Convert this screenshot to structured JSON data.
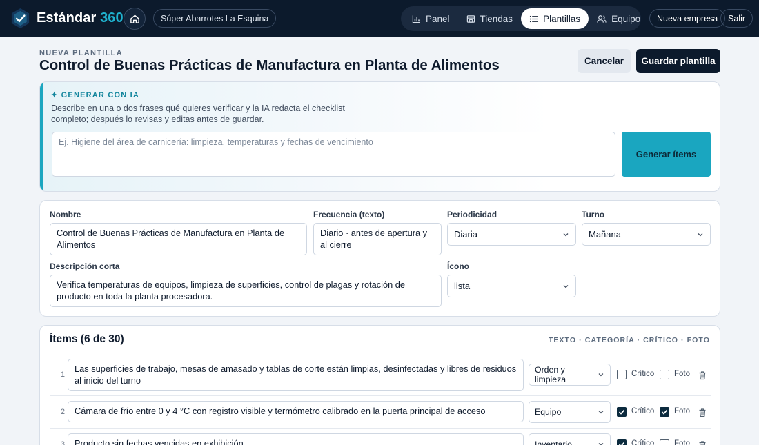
{
  "colors": {
    "topbar": "#0c1a2c",
    "accent": "#1aa6c0",
    "checked": "#0c2b3e"
  },
  "topbar": {
    "brand_name": "Estándar",
    "brand_accent": "360",
    "store": "Súper Abarrotes La Esquina",
    "nav": [
      {
        "label": "Panel",
        "icon": "bar-chart-icon"
      },
      {
        "label": "Tiendas",
        "icon": "store-icon"
      },
      {
        "label": "Plantillas",
        "icon": "list-icon",
        "active": true
      },
      {
        "label": "Equipo",
        "icon": "users-icon"
      }
    ],
    "new_company": "Nueva empresa",
    "logout": "Salir"
  },
  "header": {
    "eyebrow": "NUEVA PLANTILLA",
    "title": "Control de Buenas Prácticas de Manufactura en Planta de Alimentos",
    "cancel": "Cancelar",
    "save": "Guardar plantilla"
  },
  "ai": {
    "title": "✦ GENERAR CON IA",
    "description": "Describe en una o dos frases qué quieres verificar y la IA redacta el checklist completo; después lo revisas y editas antes de guardar.",
    "placeholder": "Ej. Higiene del área de carnicería: limpieza, temperaturas y fechas de vencimiento",
    "button": "Generar ítems"
  },
  "form": {
    "name_label": "Nombre",
    "name_value": "Control de Buenas Prácticas de Manufactura en Planta de Alimentos",
    "freq_label": "Frecuencia (texto)",
    "freq_value": "Diario · antes de apertura y al cierre",
    "period_label": "Periodicidad",
    "period_value": "Diaria",
    "shift_label": "Turno",
    "shift_value": "Mañana",
    "desc_label": "Descripción corta",
    "desc_value": "Verifica temperaturas de equipos, limpieza de superficies, control de plagas y rotación de producto en toda la planta procesadora.",
    "icon_label": "Ícono",
    "icon_value": "lista"
  },
  "items": {
    "title": "Ítems (6 de 30)",
    "legend": "TEXTO · CATEGORÍA · CRÍTICO · FOTO",
    "critical_label": "Crítico",
    "photo_label": "Foto",
    "rows": [
      {
        "num": "1",
        "text": "Las superficies de trabajo, mesas de amasado y tablas de corte están limpias, desinfectadas y libres de residuos al inicio del turno",
        "category": "Orden y limpieza",
        "critical": false,
        "photo": false
      },
      {
        "num": "2",
        "text": "Cámara de frío entre 0 y 4 °C con registro visible y termómetro calibrado en la puerta principal de acceso",
        "category": "Equipo",
        "critical": true,
        "photo": true
      },
      {
        "num": "3",
        "text": "Producto sin fechas vencidas en exhibición",
        "category": "Inventario",
        "critical": true,
        "photo": false
      }
    ]
  }
}
